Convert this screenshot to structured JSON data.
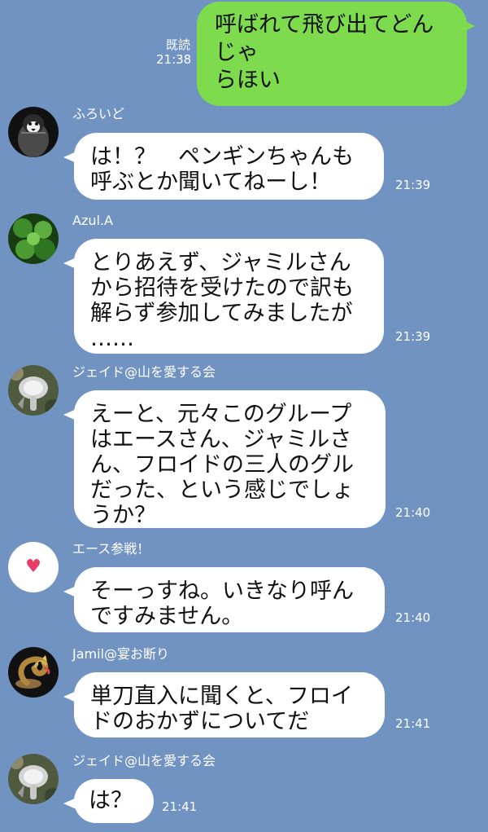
{
  "colors": {
    "background": "#7193c2",
    "outgoing_bubble": "#7ddb4d",
    "incoming_bubble": "#ffffff",
    "heart": "#e83c68"
  },
  "outgoing": {
    "read_label": "既読",
    "time": "21:38",
    "text": "呼ばれて飛び出てどんじゃ\nらほい"
  },
  "messages": [
    {
      "sender": "ふろいど",
      "avatar_icon": "penguin-avatar-icon",
      "text": "は！？　ペンギンちゃんも\n呼ぶとか聞いてねーし！",
      "time": "21:39"
    },
    {
      "sender": "Azul.A",
      "avatar_icon": "leaf-avatar-icon",
      "text": "とりあえず、ジャミルさん\nから招待を受けたので訳も\n解らず参加してみましたが\n……",
      "time": "21:39"
    },
    {
      "sender": "ジェイド@山を愛する会",
      "avatar_icon": "mushroom-avatar-icon",
      "text": "えーと、元々このグループ\nはエースさん、ジャミルさ\nん、フロイドの三人のグル\nだった、という感じでしょ\nうか？",
      "time": "21:40"
    },
    {
      "sender": "エース参戦！",
      "avatar_icon": "heart-avatar-icon",
      "text": "そーっすね。いきなり呼ん\nですみません。",
      "time": "21:40"
    },
    {
      "sender": "Jamil@宴お断り",
      "avatar_icon": "snake-avatar-icon",
      "text": "単刀直入に聞くと、フロイ\nドのおかずについてだ",
      "time": "21:41"
    },
    {
      "sender": "ジェイド@山を愛する会",
      "avatar_icon": "mushroom-avatar-icon",
      "text": "は？",
      "time": "21:41"
    }
  ]
}
